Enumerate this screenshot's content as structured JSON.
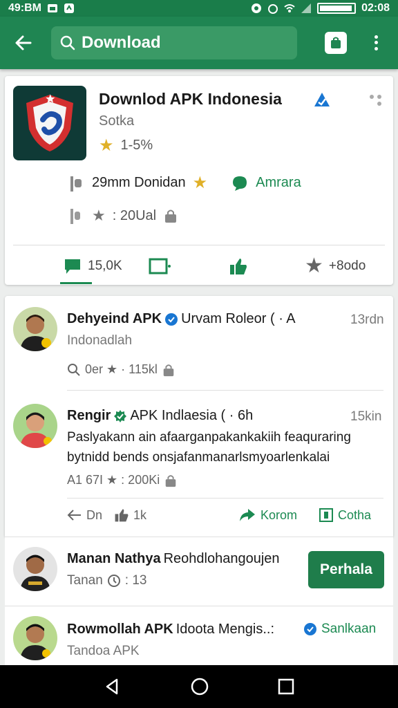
{
  "status_bar": {
    "time_left": "49:BM",
    "time_right": "02:08",
    "battery_level": 0.95
  },
  "search": {
    "value": "Download"
  },
  "app": {
    "title": "Downlod APK Indonesia",
    "developer": "Sotka",
    "rating": "1-5%",
    "downloads": "29mm Donidan",
    "category": "Amrara",
    "reviews": ": 20Ual",
    "actions": [
      {
        "icon": "comment-icon",
        "label": "15,0K"
      },
      {
        "icon": "square-icon",
        "label": ""
      },
      {
        "icon": "thumbs-up-icon",
        "label": ""
      },
      {
        "icon": "star-icon",
        "label": "+8odo"
      }
    ]
  },
  "posts": [
    {
      "name": "Dehyeind APK",
      "name_rest": "Urvam Roleor ( · A",
      "time": "13rdn",
      "subtitle": "Indonadlah",
      "meta": "0er ★ · 115kl"
    },
    {
      "name": "Rengir",
      "name_rest": "APK  Indlaesia ( · 6h",
      "time": "15kin",
      "body": "Paslyakann ain afaarganpakankakiih feaquraring bytnidd bends onsjafanmanarlsmyoarlenkalai",
      "meta": "A1 67I ★ : 200Ki",
      "actions": {
        "a": "Dn",
        "like": "1k",
        "share": "Korom",
        "other": "Cotha"
      }
    },
    {
      "name": "Manan Nathya",
      "name_rest": "Reohdlohangoujen",
      "subtitle": "Tanan",
      "meta": ": 13",
      "button": "Perhala"
    },
    {
      "name": "Rowmollah APK",
      "name_rest": "Idoota Mengis..:",
      "subtitle": "Tandoa APK",
      "action": "Sanlkaan"
    }
  ]
}
